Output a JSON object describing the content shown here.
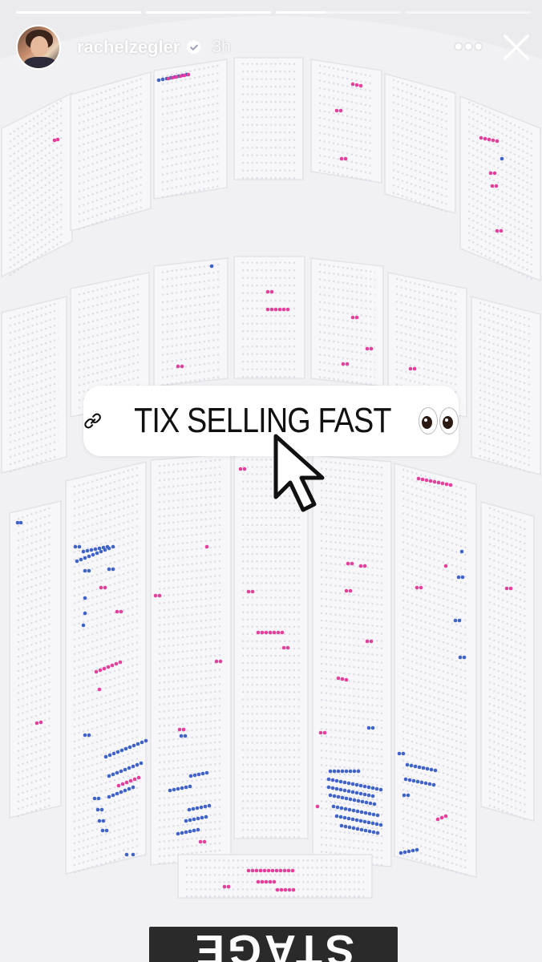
{
  "story": {
    "username": "rachelzegler",
    "verified": true,
    "time_ago": "3h",
    "segments": [
      {
        "progress": 1.0
      },
      {
        "progress": 1.0
      },
      {
        "progress": 0.4
      },
      {
        "progress": 0.0
      }
    ]
  },
  "header": {
    "avatar_icon": "avatar-photo",
    "more_icon": "more-horizontal-icon",
    "close_icon": "close-icon"
  },
  "link_sticker": {
    "icon": "link-icon",
    "text": "TIX SELLING FAST",
    "emoji": "eyes-emoji"
  },
  "seat_map": {
    "stage_label": "STAGE",
    "colors": {
      "available": "#dcdce6",
      "selected_pink": "#e33f9b",
      "selected_blue": "#3f63c9",
      "section_fill": "#f7f7f9",
      "background": "#ebebee"
    }
  }
}
